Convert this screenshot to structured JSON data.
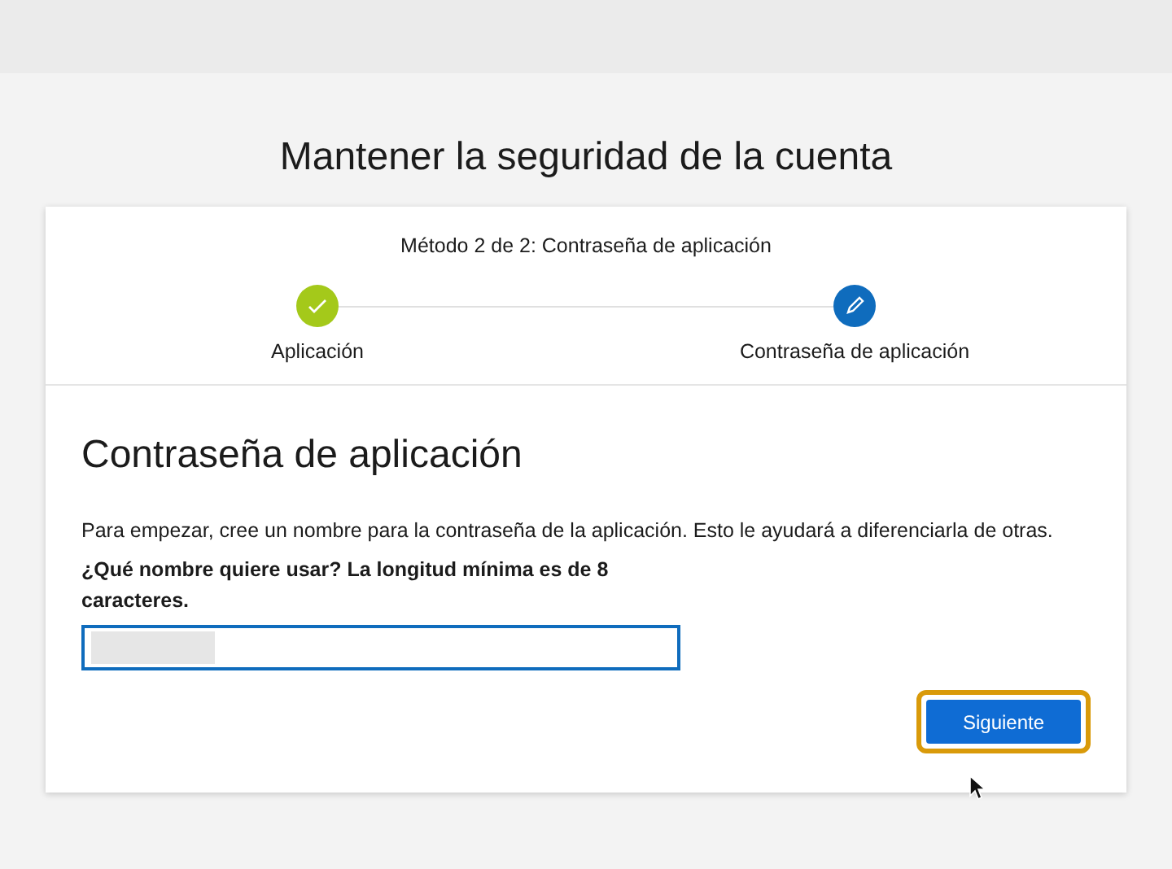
{
  "page_title": "Mantener la seguridad de la cuenta",
  "progress": {
    "caption": "Método 2 de 2: Contraseña de aplicación",
    "steps": [
      {
        "label": "Aplicación",
        "kind": "completed"
      },
      {
        "label": "Contraseña de aplicación",
        "kind": "current"
      }
    ]
  },
  "section": {
    "heading": "Contraseña de aplicación",
    "intro": "Para empezar, cree un nombre para la contraseña de la aplicación. Esto le ayudará a diferenciarla de otras.",
    "field_label": "¿Qué nombre quiere usar? La longitud mínima es de 8 caracteres.",
    "field": {
      "focused": true,
      "redacted": true
    }
  },
  "next_button": {
    "label": "Siguiente",
    "focused": true
  }
}
